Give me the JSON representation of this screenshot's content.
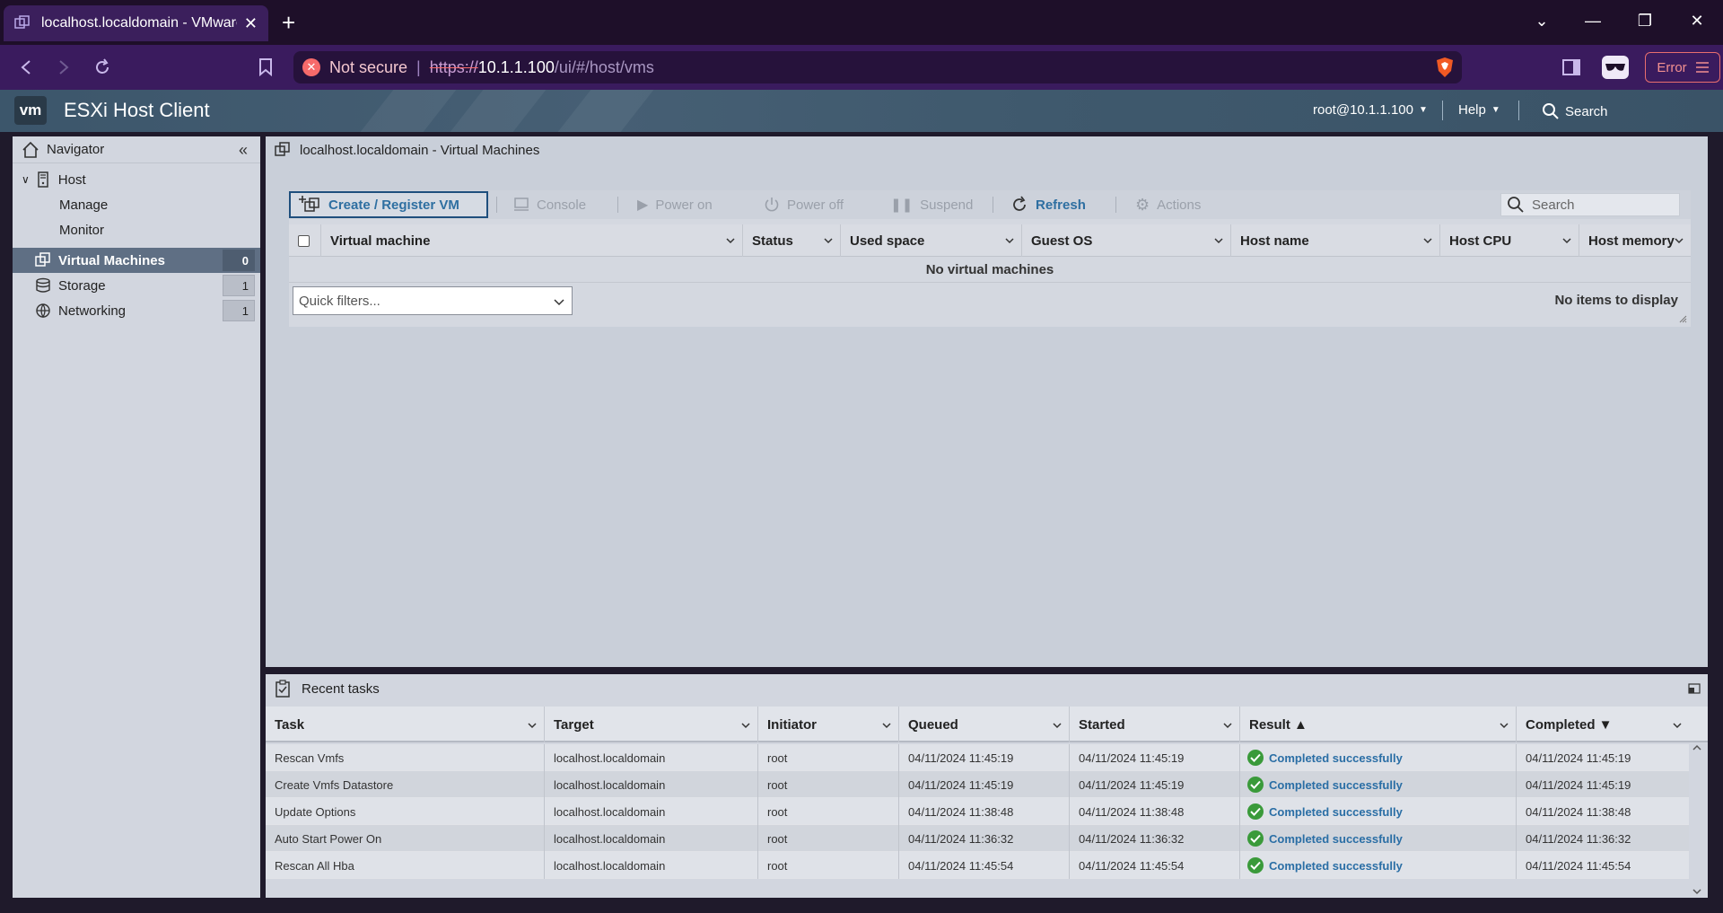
{
  "browser": {
    "tab_title": "localhost.localdomain - VMware",
    "url_warning": "Not secure",
    "url_scheme": "https://",
    "url_host": "10.1.1.100",
    "url_path": "/ui/#/host/vms",
    "error_label": "Error"
  },
  "header": {
    "logo": "vm",
    "app_title": "ESXi Host Client",
    "user": "root@10.1.1.100",
    "help": "Help",
    "search": "Search"
  },
  "navigator": {
    "title": "Navigator",
    "host": "Host",
    "manage": "Manage",
    "monitor": "Monitor",
    "items": [
      {
        "label": "Virtual Machines",
        "count": "0"
      },
      {
        "label": "Storage",
        "count": "1"
      },
      {
        "label": "Networking",
        "count": "1"
      }
    ]
  },
  "main": {
    "title": "localhost.localdomain - Virtual Machines",
    "toolbar": {
      "create": "Create / Register VM",
      "console": "Console",
      "power_on": "Power on",
      "power_off": "Power off",
      "suspend": "Suspend",
      "refresh": "Refresh",
      "actions": "Actions",
      "search_placeholder": "Search"
    },
    "columns": [
      "Virtual machine",
      "Status",
      "Used space",
      "Guest OS",
      "Host name",
      "Host CPU",
      "Host memory"
    ],
    "empty_message": "No virtual machines",
    "quick_filters_placeholder": "Quick filters...",
    "items_status": "No items to display"
  },
  "tasks": {
    "title": "Recent tasks",
    "columns": [
      "Task",
      "Target",
      "Initiator",
      "Queued",
      "Started",
      "Result ▲",
      "Completed ▼"
    ],
    "rows": [
      {
        "task": "Rescan Vmfs",
        "target": "localhost.localdomain",
        "initiator": "root",
        "queued": "04/11/2024 11:45:19",
        "started": "04/11/2024 11:45:19",
        "result": "Completed successfully",
        "completed": "04/11/2024 11:45:19"
      },
      {
        "task": "Create Vmfs Datastore",
        "target": "localhost.localdomain",
        "initiator": "root",
        "queued": "04/11/2024 11:45:19",
        "started": "04/11/2024 11:45:19",
        "result": "Completed successfully",
        "completed": "04/11/2024 11:45:19"
      },
      {
        "task": "Update Options",
        "target": "localhost.localdomain",
        "initiator": "root",
        "queued": "04/11/2024 11:38:48",
        "started": "04/11/2024 11:38:48",
        "result": "Completed successfully",
        "completed": "04/11/2024 11:38:48"
      },
      {
        "task": "Auto Start Power On",
        "target": "localhost.localdomain",
        "initiator": "root",
        "queued": "04/11/2024 11:36:32",
        "started": "04/11/2024 11:36:32",
        "result": "Completed successfully",
        "completed": "04/11/2024 11:36:32"
      },
      {
        "task": "Rescan All Hba",
        "target": "localhost.localdomain",
        "initiator": "root",
        "queued": "04/11/2024 11:45:54",
        "started": "04/11/2024 11:45:54",
        "result": "Completed successfully",
        "completed": "04/11/2024 11:45:54"
      }
    ]
  },
  "colors": {
    "browser_tabbar": "#1e0f29",
    "browser_navbar": "#3a1b5e",
    "accent_blue": "#2e6fa1",
    "success_green": "#3a9a3a",
    "nav_selected": "#5f6f84"
  }
}
